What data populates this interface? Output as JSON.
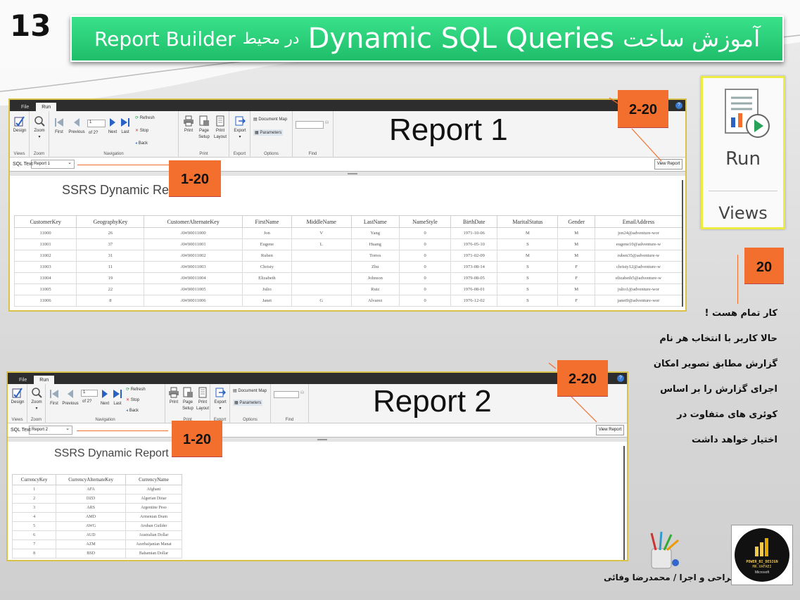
{
  "slide": {
    "number": "13",
    "title_part1": "آموزش ساخت",
    "title_part2": "Dynamic SQL Queries",
    "title_part3": "در محیط",
    "title_part4": "Report Builder"
  },
  "ribbon": {
    "tabs": [
      "File",
      "Run"
    ],
    "help": "?",
    "design": "Design",
    "zoom": "Zoom",
    "first": "First",
    "previous": "Previous",
    "page_value": "1",
    "page_of": "of 2?",
    "next": "Next",
    "last": "Last",
    "refresh": "Refresh",
    "stop": "Stop",
    "back": "Back",
    "print": "Print",
    "page_setup_1": "Page",
    "page_setup_2": "Setup",
    "print_layout_1": "Print",
    "print_layout_2": "Layout",
    "export": "Export",
    "document_map": "Document Map",
    "parameters": "Parameters",
    "groups": {
      "views": "Views",
      "zoom": "Zoom",
      "navigation": "Navigation",
      "print": "Print",
      "export": "Export",
      "options": "Options",
      "find": "Find"
    },
    "sql_text_label": "SQL Text",
    "view_report": "View Report"
  },
  "report1": {
    "overlay_title": "Report 1",
    "select_value": "Report 1",
    "title": "SSRS Dynamic Report",
    "columns": [
      "CustomerKey",
      "GeographyKey",
      "CustomerAlternateKey",
      "FirstName",
      "MiddleName",
      "LastName",
      "NameStyle",
      "BirthDate",
      "MaritalStatus",
      "Gender",
      "EmailAddress"
    ],
    "rows": [
      [
        "11000",
        "26",
        "AW00011000",
        "Jon",
        "V",
        "Yang",
        "0",
        "1971-10-06",
        "M",
        "M",
        "jon24@adventure-wor"
      ],
      [
        "11001",
        "37",
        "AW00011001",
        "Eugene",
        "L",
        "Huang",
        "0",
        "1976-05-10",
        "S",
        "M",
        "eugene10@adventure-w"
      ],
      [
        "11002",
        "31",
        "AW00011002",
        "Ruben",
        "",
        "Torres",
        "0",
        "1971-02-09",
        "M",
        "M",
        "ruben35@adventure-w"
      ],
      [
        "11003",
        "11",
        "AW00011003",
        "Christy",
        "",
        "Zhu",
        "0",
        "1973-08-14",
        "S",
        "F",
        "christy12@adventure-w"
      ],
      [
        "11004",
        "19",
        "AW00011004",
        "Elizabeth",
        "",
        "Johnson",
        "0",
        "1979-08-05",
        "S",
        "F",
        "elizabeth5@adventure-w"
      ],
      [
        "11005",
        "22",
        "AW00011005",
        "Julio",
        "",
        "Ruiz",
        "0",
        "1976-08-01",
        "S",
        "M",
        "julio1@adventure-wor"
      ],
      [
        "11006",
        "8",
        "AW00011006",
        "Janet",
        "G",
        "Alvarez",
        "0",
        "1976-12-02",
        "S",
        "F",
        "janet9@adventure-wor"
      ]
    ]
  },
  "report2": {
    "overlay_title": "Report 2",
    "select_value": "Report 2",
    "title": "SSRS Dynamic Report",
    "columns": [
      "CurrencyKey",
      "CurrencyAlternateKey",
      "CurrencyName"
    ],
    "rows": [
      [
        "1",
        "AFA",
        "Afghani"
      ],
      [
        "2",
        "DZD",
        "Algerian Dinar"
      ],
      [
        "3",
        "ARS",
        "Argentine Peso"
      ],
      [
        "4",
        "AMD",
        "Armenian Dram"
      ],
      [
        "5",
        "AWG",
        "Aruban Guilder"
      ],
      [
        "6",
        "AUD",
        "Australian Dollar"
      ],
      [
        "7",
        "AZM",
        "Azerbaijanian Manat"
      ],
      [
        "8",
        "BSD",
        "Bahamian Dollar"
      ]
    ]
  },
  "badges": {
    "b1": "2-20",
    "b2": "1-20",
    "b3": "20",
    "b4": "2-20",
    "b5": "1-20"
  },
  "run_panel": {
    "run": "Run",
    "views": "Views"
  },
  "persian_text": {
    "line1": "کار تمام هست !",
    "line2": "حالا کاربر با انتخاب هر نام",
    "line3": "گزارش مطابق تصویر امکان",
    "line4": "اجرای گزارش را بر اساس",
    "line5": "کوئری های متفاوت در",
    "line6": "اختیار خواهد داشت"
  },
  "credit": "طراحی و اجرا / محمدرضا وفائی",
  "logo": {
    "line1": "POWER_BI_DESIGN",
    "line2": "MR.VAFAEI",
    "line3": "Microsoft"
  },
  "colors": {
    "title_green": "#2fd37b",
    "badge_orange": "#f26f2e",
    "highlight_yellow": "#ecec44"
  }
}
